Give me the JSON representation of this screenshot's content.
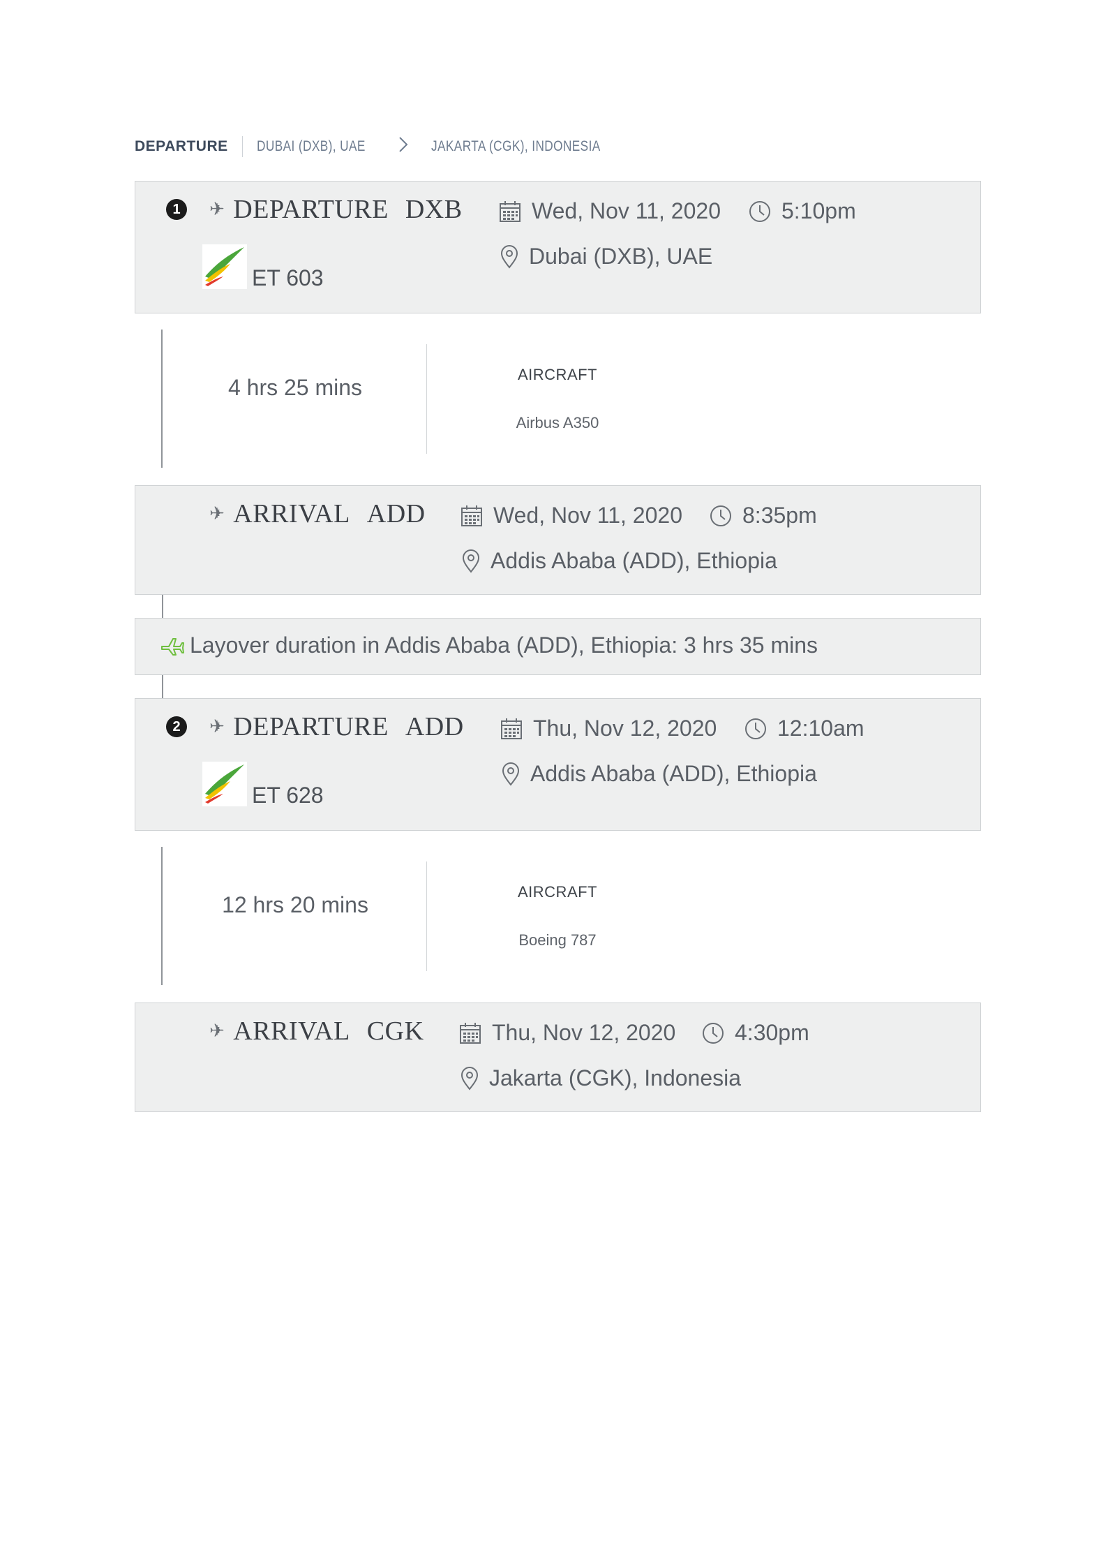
{
  "breadcrumb": {
    "title": "DEPARTURE",
    "origin": "DUBAI (DXB), UAE",
    "arrow": ">",
    "destination": "JAKARTA (CGK), INDONESIA"
  },
  "segments": [
    {
      "number": "1",
      "departure": {
        "label": "DEPARTURE",
        "code": "DXB",
        "date": "Wed, Nov 11, 2020",
        "time": "5:10pm",
        "location": "Dubai (DXB), UAE"
      },
      "flight_number": "ET 603",
      "duration": "4 hrs 25 mins",
      "aircraft_label": "AIRCRAFT",
      "aircraft": "Airbus A350",
      "arrival": {
        "label": "ARRIVAL",
        "code": "ADD",
        "date": "Wed, Nov 11, 2020",
        "time": "8:35pm",
        "location": "Addis Ababa (ADD), Ethiopia"
      }
    },
    {
      "number": "2",
      "departure": {
        "label": "DEPARTURE",
        "code": "ADD",
        "date": "Thu, Nov 12, 2020",
        "time": "12:10am",
        "location": "Addis Ababa (ADD), Ethiopia"
      },
      "flight_number": "ET 628",
      "duration": "12 hrs 20 mins",
      "aircraft_label": "AIRCRAFT",
      "aircraft": "Boeing 787",
      "arrival": {
        "label": "ARRIVAL",
        "code": "CGK",
        "date": "Thu, Nov 12, 2020",
        "time": "4:30pm",
        "location": "Jakarta (CGK), Indonesia"
      }
    }
  ],
  "layover": {
    "text": "Layover duration in Addis Ababa (ADD), Ethiopia: 3 hrs 35 mins"
  },
  "colors": {
    "card_bg": "#eeefef",
    "card_border": "#cfd2d4",
    "layover_plane": "#6fbf3f",
    "logo_green": "#4aa63a",
    "logo_yellow": "#f2c200",
    "logo_red": "#e23a2c"
  }
}
